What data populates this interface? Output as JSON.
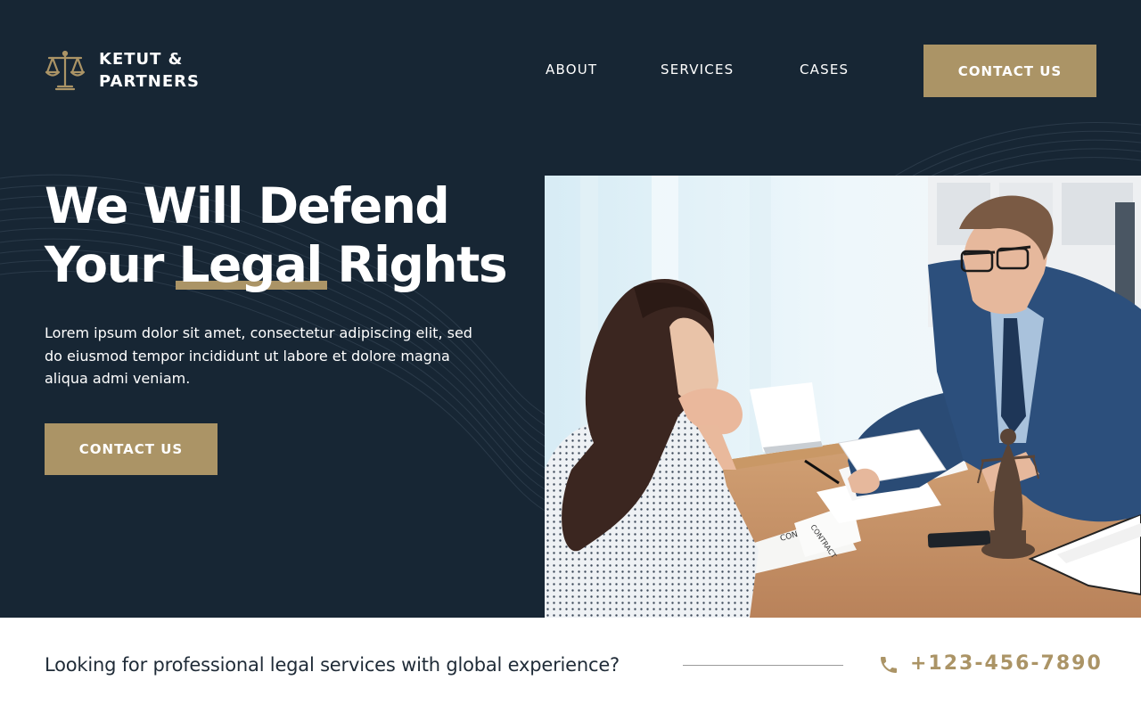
{
  "brand": {
    "line1": "KETUT &",
    "line2": "PARTNERS",
    "logo_icon": "scales-of-justice-icon"
  },
  "nav": {
    "items": [
      {
        "label": "ABOUT"
      },
      {
        "label": "SERVICES"
      },
      {
        "label": "CASES"
      }
    ],
    "cta_label": "CONTACT US"
  },
  "hero": {
    "headline_line1": "We Will Defend",
    "headline_line2_pre": "Your ",
    "headline_line2_highlight": "Legal",
    "headline_line2_post": " Rights",
    "body": "Lorem ipsum dolor sit amet, consectetur adipiscing elit, sed do eiusmod tempor incididunt ut labore et dolore magna aliqua admi veniam.",
    "cta_label": "CONTACT US",
    "image_texts": {
      "doc1": "CONTRACT",
      "doc2": "CONTRACT"
    }
  },
  "footer_bar": {
    "tagline": "Looking for professional legal services with global experience?",
    "phone": "+123-456-7890",
    "phone_icon": "phone-icon"
  },
  "colors": {
    "navy": "#172634",
    "gold": "#ab9466",
    "white": "#ffffff",
    "text_dark": "#1f2b37"
  }
}
